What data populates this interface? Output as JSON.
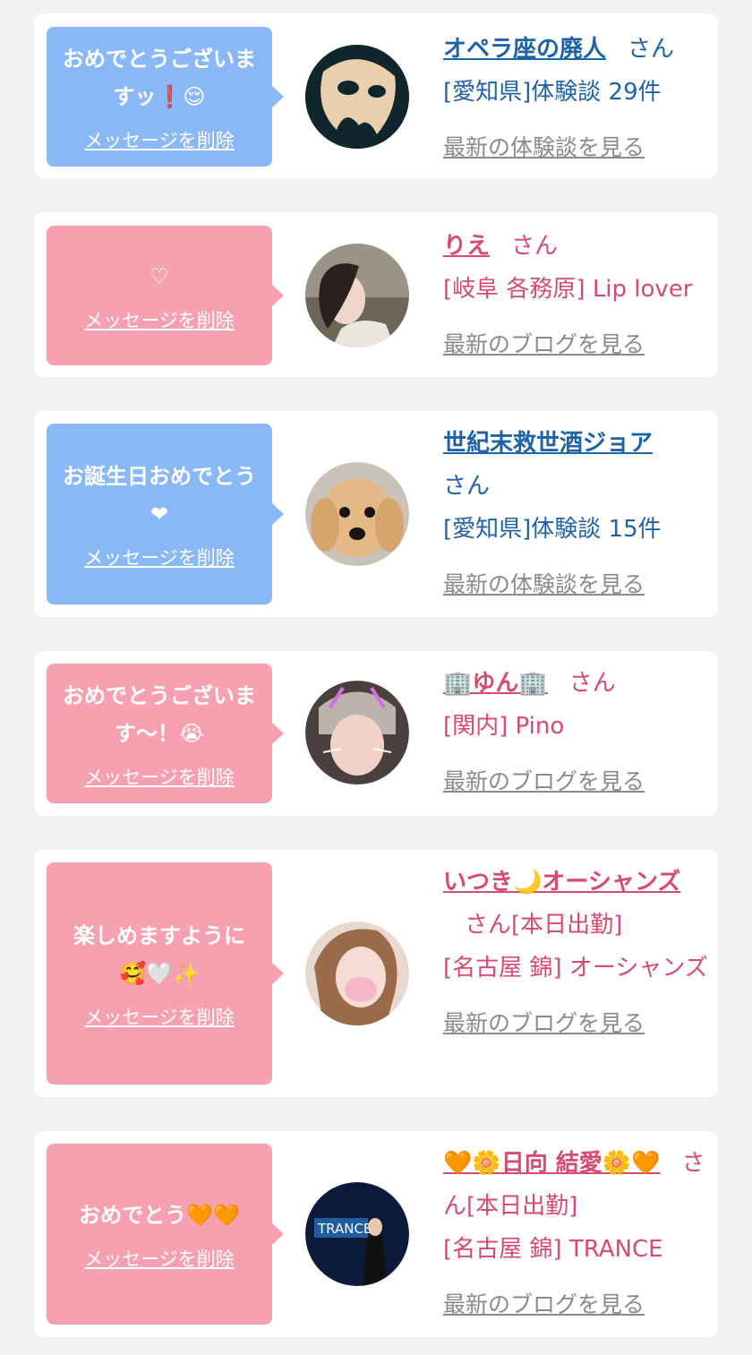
{
  "delete_label": "メッセージを削除",
  "cards": [
    {
      "color": "blue",
      "message": "おめでとうございますッ❗😌",
      "avatar": "phantom-mask-avatar",
      "name": "オペラ座の廃人",
      "honorific": "さん",
      "detail": "[愛知県]体験談 29件",
      "link": "最新の体験談を見る"
    },
    {
      "color": "pink",
      "message": "♡",
      "avatar": "woman-portrait-avatar",
      "name": "りえ",
      "honorific": "さん",
      "detail": "[岐阜 各務原] Lip lover",
      "link": "最新のブログを見る"
    },
    {
      "color": "blue",
      "message": "お誕生日おめでとう❤",
      "avatar": "dog-avatar",
      "name": "世紀末救世酒ジョア",
      "honorific": "さん",
      "detail": "[愛知県]体験談 15件",
      "link": "最新の体験談を見る"
    },
    {
      "color": "pink",
      "message": "おめでとうございます〜！😭",
      "avatar": "girl-cat-filter-avatar",
      "name": "🏢ゆん🏢",
      "honorific": "さん",
      "detail": "[関内] Pino",
      "link": "最新のブログを見る"
    },
    {
      "color": "pink",
      "message": "楽しめますように🥰🤍✨",
      "avatar": "girl-masked-face-avatar",
      "name": "いつき🌙オーシャンズ",
      "honorific": "さん[本日出勤]",
      "detail": "[名古屋 錦] オーシャンズ",
      "link": "最新のブログを見る"
    },
    {
      "color": "pink",
      "message": "おめでとう🧡🧡",
      "avatar": "trance-stage-avatar",
      "name": "🧡🌼日向 結愛🌼🧡",
      "honorific": "さん[本日出勤]",
      "detail": "[名古屋 錦] TRANCE",
      "link": "最新のブログを見る"
    }
  ]
}
